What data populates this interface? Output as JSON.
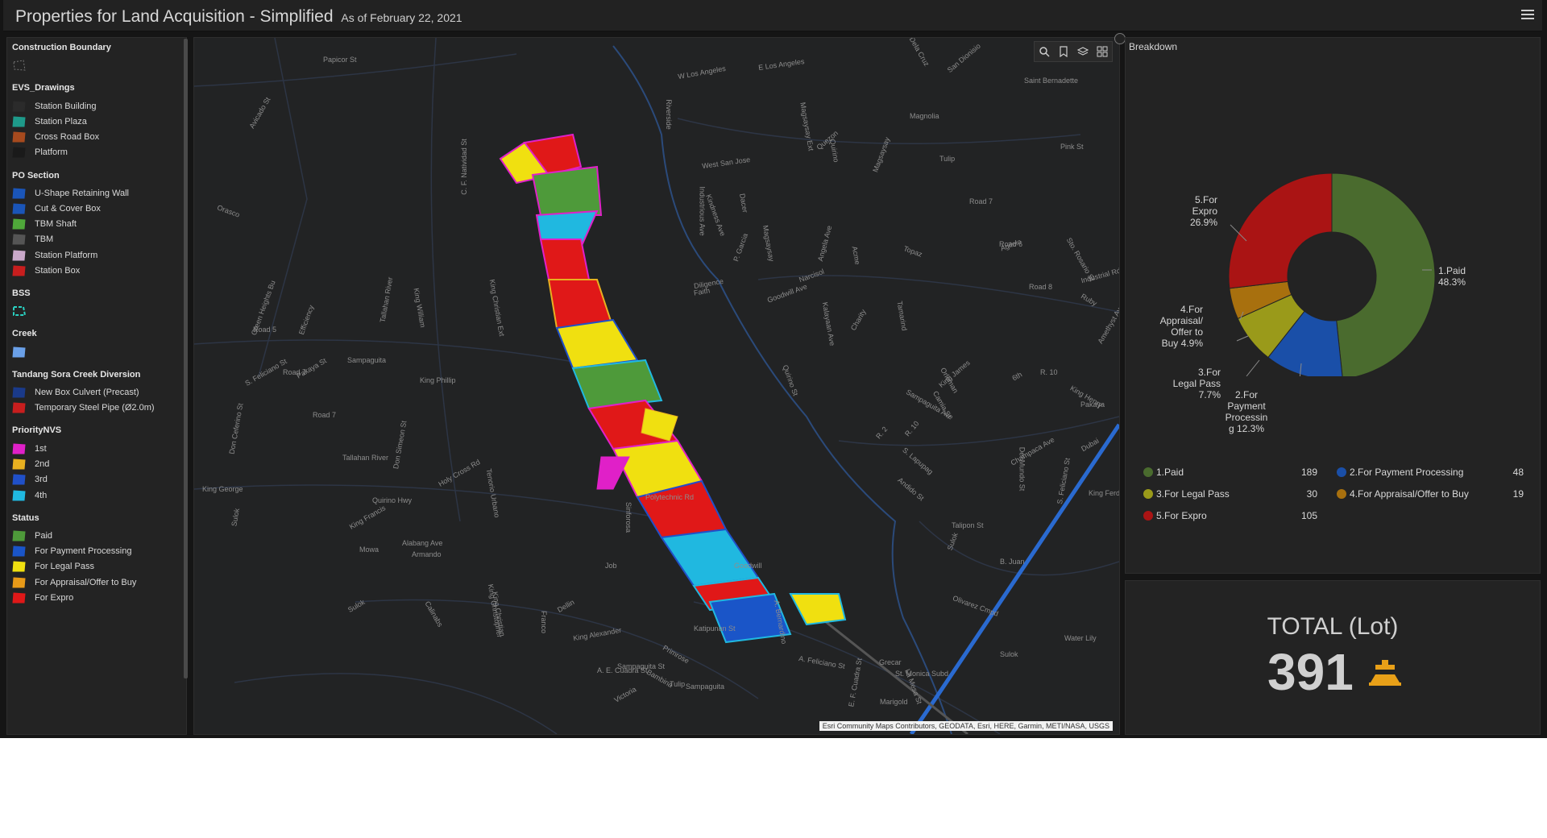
{
  "header": {
    "title": "Properties for Land Acquisition - Simplified",
    "subtitle": "As of February 22, 2021",
    "menu_icon": "hamburger-menu-icon"
  },
  "legend": {
    "sections": [
      {
        "title": "Construction Boundary",
        "items": [
          {
            "label": "",
            "icon": "dashed-boundary"
          }
        ]
      },
      {
        "title": "EVS_Drawings",
        "items": [
          {
            "label": "Station Building",
            "color": "#2b2b2b"
          },
          {
            "label": "Station Plaza",
            "color": "#1e9a8a"
          },
          {
            "label": "Cross Road Box",
            "color": "#a64a1e"
          },
          {
            "label": "Platform",
            "color": "#1a1a1a"
          }
        ]
      },
      {
        "title": "PO Section",
        "items": [
          {
            "label": "U-Shape Retaining Wall",
            "color": "#1a55b8"
          },
          {
            "label": "Cut & Cover Box",
            "color": "#1a55b8"
          },
          {
            "label": "TBM Shaft",
            "color": "#4fa83a"
          },
          {
            "label": "TBM",
            "color": "#555555"
          },
          {
            "label": "Station Platform",
            "color": "#c9a8c9"
          },
          {
            "label": "Station Box",
            "color": "#c81e1e"
          }
        ]
      },
      {
        "title": "BSS",
        "items": [
          {
            "label": "",
            "icon": "bss-dashed"
          }
        ]
      },
      {
        "title": "Creek",
        "items": [
          {
            "label": "",
            "color": "#6aa0e8"
          }
        ]
      },
      {
        "title": "Tandang Sora Creek Diversion",
        "items": [
          {
            "label": "New Box Culvert (Precast)",
            "color": "#1a3a8a"
          },
          {
            "label": "Temporary Steel Pipe (Ø2.0m)",
            "color": "#c81e1e"
          }
        ]
      },
      {
        "title": "PriorityNVS",
        "items": [
          {
            "label": "1st",
            "color": "#e020c8"
          },
          {
            "label": "2nd",
            "color": "#e8b020"
          },
          {
            "label": "3rd",
            "color": "#2050c8"
          },
          {
            "label": "4th",
            "color": "#20b8e0"
          }
        ]
      },
      {
        "title": "Status",
        "items": [
          {
            "label": "Paid",
            "color": "#4e9a3a"
          },
          {
            "label": "For Payment Processing",
            "color": "#1a55c8"
          },
          {
            "label": "For Legal Pass",
            "color": "#f0e010"
          },
          {
            "label": "For Appraisal/Offer to Buy",
            "color": "#e89a18"
          },
          {
            "label": "For Expro",
            "color": "#e01818"
          }
        ]
      }
    ]
  },
  "map": {
    "toolbar": [
      "search-icon",
      "bookmark-icon",
      "layers-icon",
      "basemap-gallery-icon"
    ],
    "attribution": "Esri Community Maps Contributors, GEODATA, Esri, HERE, Garmin, METI/NASA, USGS",
    "labels": [
      "Papicor St",
      "W Los Angeles",
      "E Los Angeles",
      "Dela Cruz",
      "San Dionisio",
      "Saint Bernadette",
      "Avicado St",
      "C. F. Natividad St",
      "Riverside",
      "West San Jose",
      "Magsaysay Ext",
      "Quezon",
      "Quirino",
      "Magsaysay",
      "Pink St",
      "Orasco",
      "Industrious Ave",
      "Kindness Ave",
      "Dacer",
      "Magsaysay",
      "Angela Ave",
      "P. Garcia",
      "Acme",
      "Topaz",
      "Agilelo",
      "Sto. Rosario St",
      "Industrial Rd",
      "Diligence",
      "Faith",
      "Goodwill Ave",
      "Charity",
      "Kalayaan Ave",
      "Tamarind",
      "Ruby",
      "Amethyst Ave",
      "Green Heights Bu",
      "Efficiency",
      "Tallahan River",
      "King William",
      "King Christian Ext",
      "Quirino St",
      "Orleman",
      "Camia St",
      "6th",
      "R. 10",
      "Pakaya",
      "S. Feliciano St",
      "Pakaya St",
      "King Phillip",
      "Sampaguita",
      "King James",
      "King Henry",
      "Champaca Ave",
      "Sampaguita Ave",
      "R. 2",
      "R. 10",
      "Don Ceferino St",
      "Don Simeon St",
      "King George",
      "Holy Cross Rd",
      "Polytechnic Rd",
      "Sinforosa",
      "Dubai",
      "Del Mundo St",
      "S. Feliciano St",
      "Talipon St",
      "King Ferdinand",
      "King Francis",
      "Tenorio Urbano",
      "Andido St",
      "S. Lapupag",
      "Sulok",
      "B. Juan",
      "Sulok",
      "Mowa",
      "Armando",
      "Job",
      "Goodwill",
      "Olivarez Cmpd",
      "Sulok",
      "Calinabs",
      "King Christian",
      "King Christopher",
      "Dellin",
      "King Alexander",
      "Katipunan St",
      "A. Bernardino",
      "A. Feliciano St",
      "Water Lily",
      "Sulok",
      "Grecar",
      "St. Monica Subd",
      "La Mesa St",
      "E. F. Cuadra St",
      "A. E. Cuadra St",
      "Bambina",
      "Sampaguita St",
      "Primrose",
      "Tulip",
      "Sampaguita",
      "Victoria",
      "Franco",
      "Narcisol",
      "Marigold",
      "Magnolia",
      "Tulip",
      "Road 7",
      "Road 6",
      "Road 8",
      "Road 5",
      "Road 7",
      "Road 7",
      "Tallahan River",
      "Quirino Hwy",
      "Alabang Ave"
    ]
  },
  "breakdown": {
    "title": "Breakdown",
    "pie_labels": [
      "1.Paid\n48.3%",
      "2.For\nPayment\nProcessin\ng 12.3%",
      "3.For\nLegal Pass\n7.7%",
      "4.For\nAppraisal/\nOffer to\nBuy 4.9%",
      "5.For\nExpro\n26.9%"
    ],
    "legend": [
      {
        "label": "1.Paid",
        "value": "189",
        "color": "#4a6b2e"
      },
      {
        "label": "2.For Payment Processing",
        "value": "48",
        "color": "#1a4fa8"
      },
      {
        "label": "3.For Legal Pass",
        "value": "30",
        "color": "#9a9a1a"
      },
      {
        "label": "4.For Appraisal/Offer to Buy",
        "value": "19",
        "color": "#a8700e"
      },
      {
        "label": "5.For Expro",
        "value": "105",
        "color": "#aa1414"
      }
    ]
  },
  "chart_data": {
    "type": "pie",
    "donut": true,
    "categories": [
      "1.Paid",
      "2.For Payment Processing",
      "3.For Legal Pass",
      "4.For Appraisal/Offer to Buy",
      "5.For Expro"
    ],
    "values": [
      189,
      48,
      30,
      19,
      105
    ],
    "percent_labels": [
      "48.3%",
      "12.3%",
      "7.7%",
      "4.9%",
      "26.9%"
    ],
    "colors": [
      "#4a6b2e",
      "#1a4fa8",
      "#9a9a1a",
      "#a8700e",
      "#aa1414"
    ],
    "title": "Breakdown"
  },
  "total": {
    "title": "TOTAL (Lot)",
    "value": "391",
    "icon": "land-acquisition-icon"
  }
}
